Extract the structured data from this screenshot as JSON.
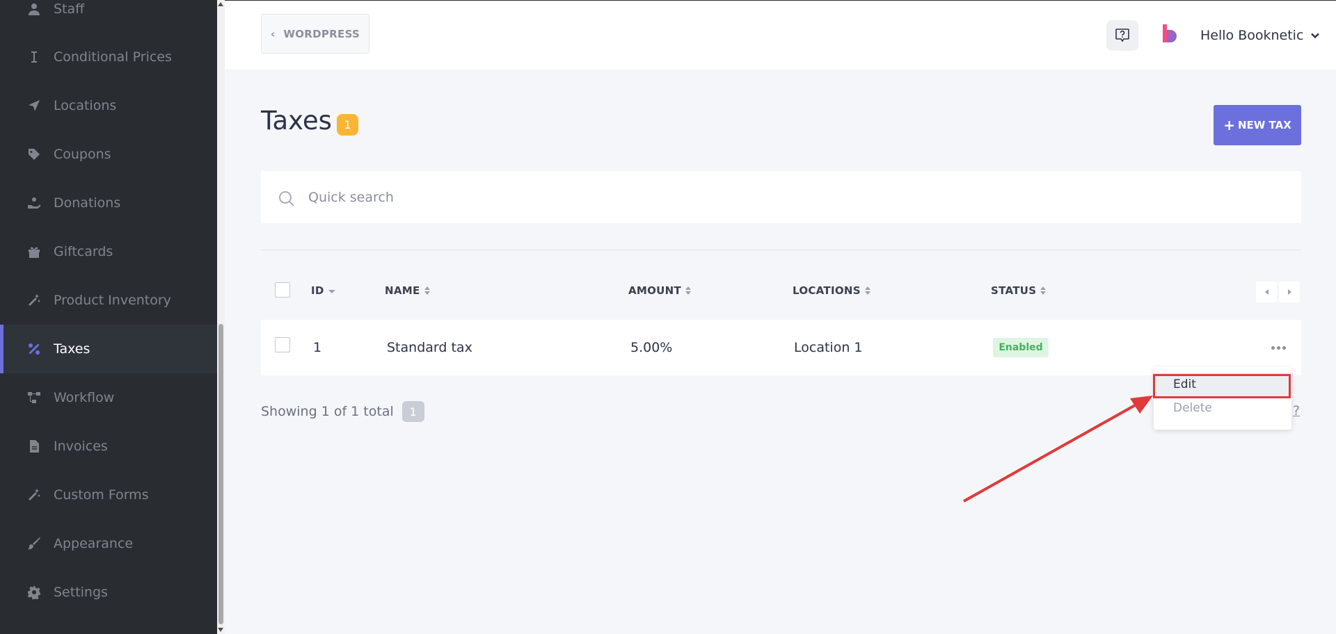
{
  "sidebar": {
    "items": [
      {
        "label": "Staff",
        "icon": "user-icon",
        "active": false
      },
      {
        "label": "Conditional Prices",
        "icon": "text-cursor-icon",
        "active": false
      },
      {
        "label": "Locations",
        "icon": "location-arrow-icon",
        "active": false
      },
      {
        "label": "Coupons",
        "icon": "tag-icon",
        "active": false
      },
      {
        "label": "Donations",
        "icon": "hand-holding-icon",
        "active": false
      },
      {
        "label": "Giftcards",
        "icon": "gift-icon",
        "active": false
      },
      {
        "label": "Product Inventory",
        "icon": "magic-wand-icon",
        "active": false
      },
      {
        "label": "Taxes",
        "icon": "percent-icon",
        "active": true
      },
      {
        "label": "Workflow",
        "icon": "workflow-icon",
        "active": false
      },
      {
        "label": "Invoices",
        "icon": "file-icon",
        "active": false
      },
      {
        "label": "Custom Forms",
        "icon": "magic-wand-icon",
        "active": false
      },
      {
        "label": "Appearance",
        "icon": "brush-icon",
        "active": false
      },
      {
        "label": "Settings",
        "icon": "gear-icon",
        "active": false
      }
    ]
  },
  "header": {
    "back_label": "WORDPRESS",
    "user_label": "Hello Booknetic"
  },
  "page": {
    "title": "Taxes",
    "count": "1",
    "new_button": "NEW TAX"
  },
  "search": {
    "placeholder": "Quick search",
    "value": ""
  },
  "table": {
    "columns": [
      "ID",
      "NAME",
      "AMOUNT",
      "LOCATIONS",
      "STATUS"
    ],
    "rows": [
      {
        "id": "1",
        "name": "Standard tax",
        "amount": "5.00%",
        "locations": "Location 1",
        "status": "Enabled"
      }
    ]
  },
  "row_menu": {
    "items": [
      "Edit",
      "Delete"
    ],
    "highlighted": "Edit"
  },
  "footer": {
    "showing": "Showing 1 of 1 total",
    "total_badge": "1",
    "help_link": "?"
  },
  "colors": {
    "accent": "#6c70dc",
    "badge": "#fbb535",
    "sidebar_bg": "#292d32",
    "status_enabled_bg": "#dff5e4",
    "status_enabled_text": "#3fb55e",
    "annotation": "#e03a3a"
  }
}
